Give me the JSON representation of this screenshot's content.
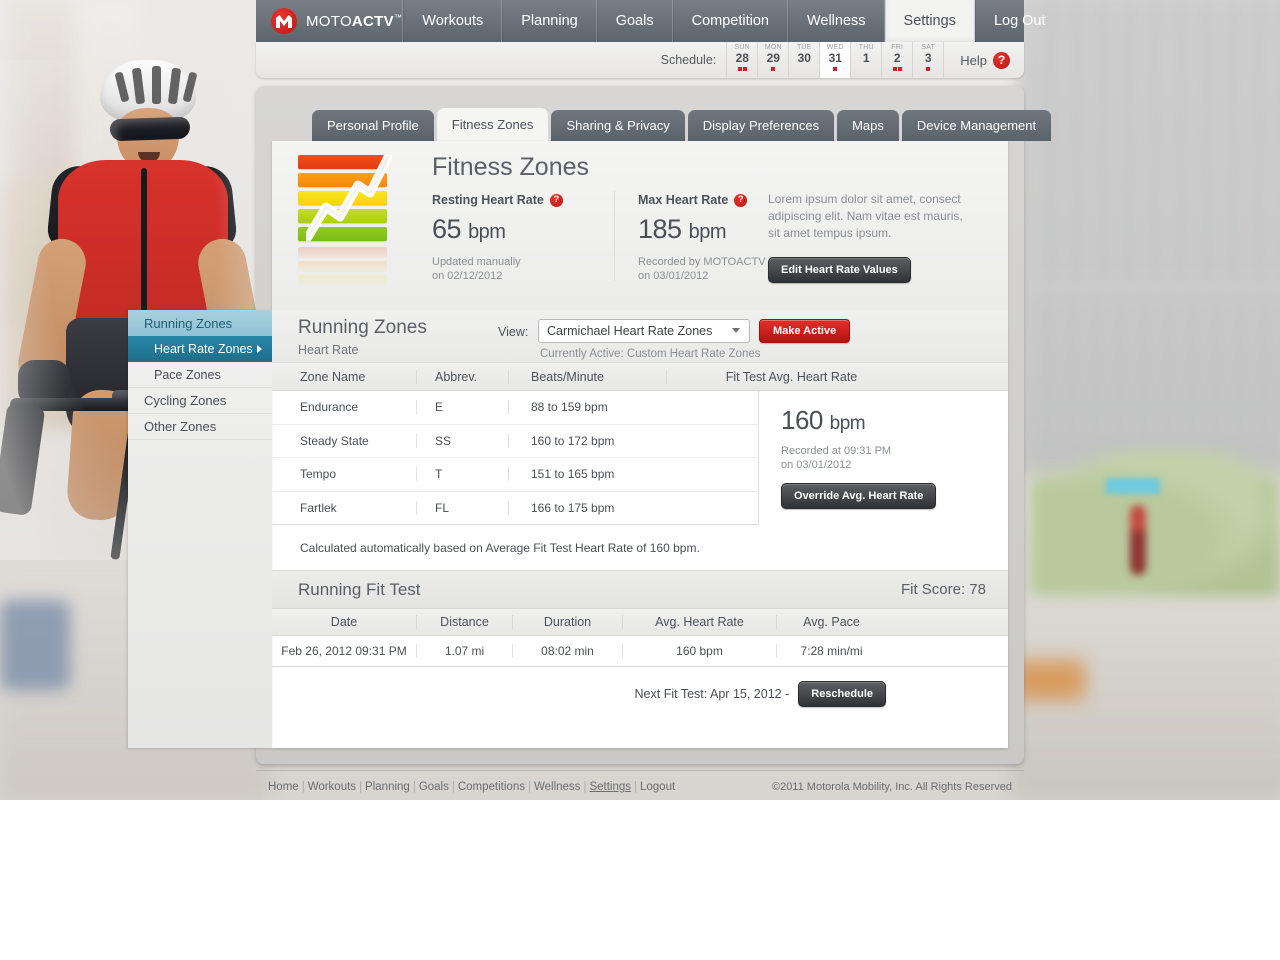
{
  "brand": {
    "name_light": "MOTO",
    "name_bold": "ACTV",
    "tm": "™",
    "logo_icon": "motorola-m-icon"
  },
  "topnav": {
    "items": [
      {
        "label": "Workouts",
        "active": false
      },
      {
        "label": "Planning",
        "active": false
      },
      {
        "label": "Goals",
        "active": false
      },
      {
        "label": "Competition",
        "active": false
      },
      {
        "label": "Wellness",
        "active": false
      },
      {
        "label": "Settings",
        "active": true
      },
      {
        "label": "Log Out",
        "active": false
      }
    ]
  },
  "schedule": {
    "label": "Schedule:",
    "days": [
      {
        "dow": "SUN",
        "num": "28",
        "dots": 2,
        "today": false
      },
      {
        "dow": "MON",
        "num": "29",
        "dots": 1,
        "today": false
      },
      {
        "dow": "TUE",
        "num": "30",
        "dots": 0,
        "today": false
      },
      {
        "dow": "WED",
        "num": "31",
        "dots": 1,
        "today": true
      },
      {
        "dow": "THU",
        "num": "1",
        "dots": 0,
        "today": false
      },
      {
        "dow": "FRI",
        "num": "2",
        "dots": 2,
        "today": false
      },
      {
        "dow": "SAT",
        "num": "3",
        "dots": 1,
        "today": false
      }
    ],
    "help_label": "Help",
    "help_icon": "question-mark-icon"
  },
  "tabs": [
    {
      "label": "Personal Profile",
      "active": false
    },
    {
      "label": "Fitness Zones",
      "active": true
    },
    {
      "label": "Sharing & Privacy",
      "active": false
    },
    {
      "label": "Display Preferences",
      "active": false
    },
    {
      "label": "Maps",
      "active": false
    },
    {
      "label": "Device Management",
      "active": false
    }
  ],
  "header": {
    "icon": "fitness-zones-chart-icon",
    "title": "Fitness Zones",
    "resting": {
      "label": "Resting Heart Rate",
      "help_icon": "question-mark-icon",
      "value": "65",
      "unit": "bpm",
      "sub_line1": "Updated manually",
      "sub_line2": "on 02/12/2012"
    },
    "max": {
      "label": "Max Heart Rate",
      "help_icon": "question-mark-icon",
      "value": "185",
      "unit": "bpm",
      "sub_line1": "Recorded by MOTOACTV",
      "sub_line2": "on 03/01/2012"
    },
    "description": "Lorem ipsum dolor sit amet, consect adipiscing elit. Nam vitae est mauris, sit amet tempus ipsum.",
    "edit_button": "Edit Heart Rate Values"
  },
  "sidebar": {
    "items": [
      {
        "label": "Running Zones",
        "type": "group",
        "state": "active"
      },
      {
        "label": "Heart Rate Zones",
        "type": "sub",
        "state": "selected",
        "arrow_icon": "chevron-right-icon"
      },
      {
        "label": "Pace Zones",
        "type": "sub",
        "state": "normal"
      },
      {
        "label": "Cycling Zones",
        "type": "group",
        "state": "normal"
      },
      {
        "label": "Other Zones",
        "type": "group",
        "state": "normal"
      }
    ]
  },
  "zones_section": {
    "title": "Running Zones",
    "subtitle": "Heart Rate",
    "view_label": "View:",
    "view_selected": "Carmichael Heart Rate Zones",
    "view_chevron_icon": "chevron-down-icon",
    "make_active_button": "Make Active",
    "currently_active": "Currently Active: Custom Heart Rate Zones",
    "columns": [
      "Zone Name",
      "Abbrev.",
      "Beats/Minute",
      "Fit Test Avg. Heart Rate"
    ],
    "rows": [
      {
        "name": "Endurance",
        "abbrev": "E",
        "bpm": "88 to 159 bpm"
      },
      {
        "name": "Steady State",
        "abbrev": "SS",
        "bpm": "160 to 172 bpm"
      },
      {
        "name": "Tempo",
        "abbrev": "T",
        "bpm": "151 to 165 bpm"
      },
      {
        "name": "Fartlek",
        "abbrev": "FL",
        "bpm": "166 to 175 bpm"
      }
    ],
    "fit_avg": {
      "value": "160",
      "unit": "bpm",
      "sub_line1": "Recorded at 09:31 PM",
      "sub_line2": "on 03/01/2012",
      "override_button": "Override Avg. Heart Rate"
    },
    "calc_note": "Calculated automatically based on Average Fit Test Heart Rate of 160 bpm."
  },
  "fit_test": {
    "title": "Running Fit Test",
    "score_label": "Fit Score: 78",
    "columns": [
      "Date",
      "Distance",
      "Duration",
      "Avg. Heart Rate",
      "Avg. Pace"
    ],
    "rows": [
      {
        "date": "Feb 26, 2012 09:31 PM",
        "distance": "1.07 mi",
        "duration": "08:02 min",
        "avg_hr": "160 bpm",
        "avg_pace": "7:28 min/mi"
      }
    ],
    "next_label": "Next Fit Test: Apr 15, 2012 -",
    "reschedule_button": "Reschedule"
  },
  "footer": {
    "links": [
      "Home",
      "Workouts",
      "Planning",
      "Goals",
      "Competitions",
      "Wellness",
      "Settings",
      "Logout"
    ],
    "current": "Settings",
    "copyright": "©2011 Motorola Mobility, Inc. All Rights Reserved"
  },
  "colors": {
    "brand_red": "#cc2229",
    "nav_gray": "#5c646d",
    "teal_group": "#90c2d4",
    "teal_selected": "#1d6e8c"
  }
}
